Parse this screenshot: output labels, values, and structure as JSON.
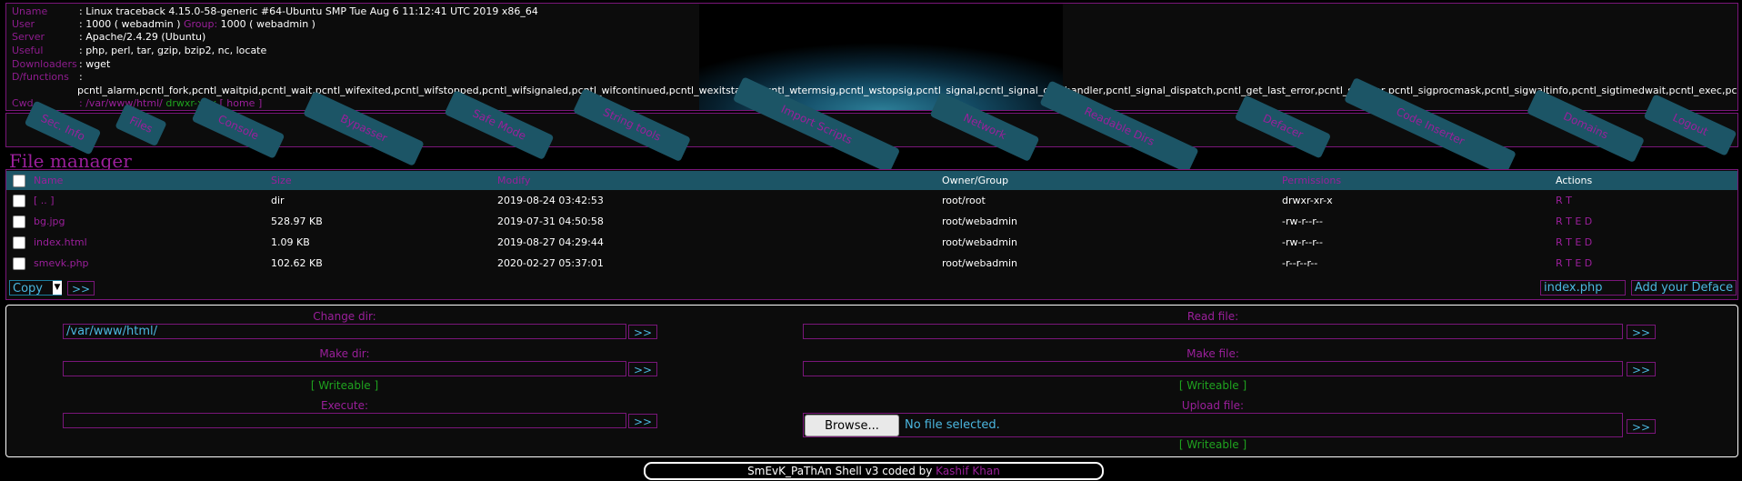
{
  "info": {
    "uname_label": "Uname",
    "uname_value": ": Linux traceback 4.15.0-58-generic #64-Ubuntu SMP Tue Aug 6 11:12:41 UTC 2019 x86_64",
    "user_label": "User",
    "user_value_a": ": 1000 ( webadmin ) ",
    "group_label": "Group:",
    "user_value_b": " 1000 ( webadmin )",
    "server_label": "Server",
    "server_value": ": Apache/2.4.29 (Ubuntu)",
    "useful_label": "Useful",
    "useful_value": ": php, perl, tar, gzip, bzip2, nc, locate",
    "downloaders_label": "Downloaders",
    "downloaders_value": ": wget",
    "dfunctions_label": "D/functions",
    "dfunctions_colon": ":",
    "dfunctions_value": "pcntl_alarm,pcntl_fork,pcntl_waitpid,pcntl_wait,pcntl_wifexited,pcntl_wifstopped,pcntl_wifsignaled,pcntl_wifcontinued,pcntl_wexitstatus,pcntl_wtermsig,pcntl_wstopsig,pcntl_signal,pcntl_signal_get_handler,pcntl_signal_dispatch,pcntl_get_last_error,pcntl_strerror,pcntl_sigprocmask,pcntl_sigwaitinfo,pcntl_sigtimedwait,pcntl_exec,pcntl_getpriority,pcntl_setpriority",
    "cwd_label": "Cwd",
    "cwd_value": ": /var/www/html/",
    "cwd_perm": " drwxr-xr-x ",
    "cwd_home": "[ home ]"
  },
  "menu": {
    "items": [
      "Sec. Info",
      "Files",
      "Console",
      "Bypasser",
      "Safe Mode",
      "String tools",
      "Import Scripts",
      "Network",
      "Readable Dirs",
      "Defacer",
      "Code Inserter",
      "Domains",
      "Logout"
    ]
  },
  "file_manager": {
    "title": "File manager",
    "columns": [
      "Name",
      "Size",
      "Modify",
      "Owner/Group",
      "Permissions",
      "Actions"
    ],
    "rows": [
      {
        "name": "[ .. ]",
        "size": "dir",
        "modify": "2019-08-24 03:42:53",
        "owner": "root/root",
        "perms": "drwxr-xr-x",
        "actions": "R T"
      },
      {
        "name": "bg.jpg",
        "size": "528.97 KB",
        "modify": "2019-07-31 04:50:58",
        "owner": "root/webadmin",
        "perms": "-rw-r--r--",
        "actions": "R T E D"
      },
      {
        "name": "index.html",
        "size": "1.09 KB",
        "modify": "2019-08-27 04:29:44",
        "owner": "root/webadmin",
        "perms": "-rw-r--r--",
        "actions": "R T E D"
      },
      {
        "name": "smevk.php",
        "size": "102.62 KB",
        "modify": "2020-02-27 05:37:01",
        "owner": "root/webadmin",
        "perms": "-r--r--r--",
        "actions": "R T E D"
      }
    ],
    "copy_select": "Copy",
    "go_label": ">>",
    "deface_file": "index.php",
    "deface_button": "Add your Deface"
  },
  "tools": {
    "change_dir_label": "Change dir:",
    "change_dir_value": "/var/www/html/",
    "make_dir_label": "Make dir:",
    "execute_label": "Execute:",
    "read_file_label": "Read file:",
    "make_file_label": "Make file:",
    "upload_file_label": "Upload file:",
    "writeable": "[ Writeable ]",
    "go": ">>",
    "browse": "Browse...",
    "no_file": "No file selected."
  },
  "footer": {
    "text": "SmEvK_PaThAn Shell v3 coded by ",
    "author": "Kashif Khan"
  },
  "colors": {
    "accent": "#9b1f9b",
    "header_bar": "#1c5566",
    "writeable": "#1fa31f",
    "input_text": "#4bb7e0"
  }
}
